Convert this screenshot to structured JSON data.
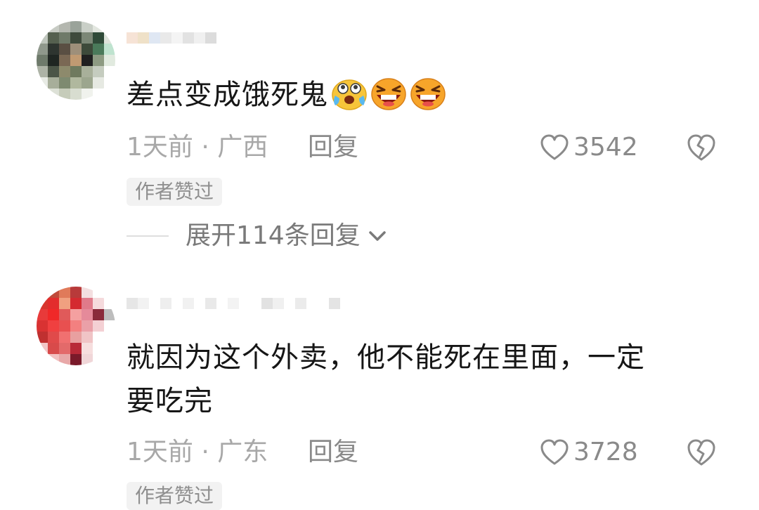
{
  "comments": [
    {
      "text": "差点变成饿死鬼",
      "emojis": [
        "crying-laughing-emoji",
        "grinning-emoji",
        "grinning-emoji"
      ],
      "time_location": "1天前 · 广西",
      "reply_label": "回复",
      "likes": "3542",
      "badge": "作者赞过",
      "expand_label": "展开114条回复"
    },
    {
      "text_line1": "就因为这个外卖，他不能死在里面，一定",
      "text_line2": "要吃完",
      "time_location": "1天前 · 广东",
      "reply_label": "回复",
      "likes": "3728",
      "badge": "作者赞过"
    }
  ],
  "icons": {
    "like": "heart-outline-icon",
    "dislike": "broken-heart-icon",
    "expand": "chevron-down-icon"
  },
  "colors": {
    "text_primary": "#161616",
    "text_meta": "#a8a8a8",
    "text_secondary": "#8a8a8a",
    "badge_bg": "#f2f2f2"
  }
}
